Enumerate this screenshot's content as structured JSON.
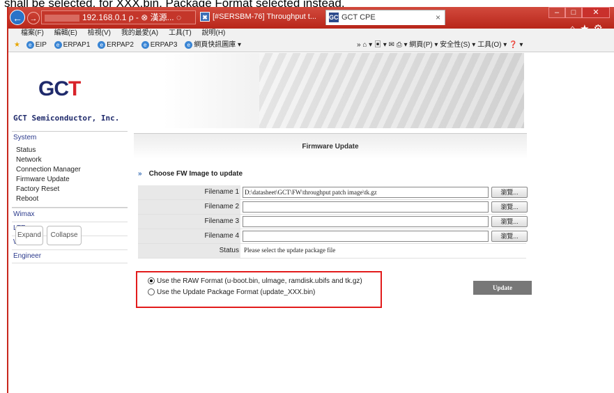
{
  "doc_caption": "shall be selected, for XXX.bin, Package Format selected instead.",
  "browser": {
    "address": "192.168.0.1",
    "address_suffix": "ρ - ⊗ 漢源... ◌",
    "tab_jira": "[#SERSBM-76] Throughput t...",
    "tab_active": "GCT CPE",
    "tab_close": "×",
    "favicon_text": "GCT",
    "menu": [
      "檔案(F)",
      "編輯(E)",
      "檢視(V)",
      "我的最愛(A)",
      "工具(T)",
      "說明(H)"
    ],
    "favorites": [
      "EIP",
      "ERPAP1",
      "ERPAP2",
      "ERPAP3",
      "網頁快訊圖庫 ▾"
    ],
    "tools": "»  ⌂ ▾  ▣ ▾  ✉  ⎙ ▾  網頁(P) ▾  安全性(S) ▾  工具(O) ▾  ❓ ▾"
  },
  "brand": {
    "logo_main": "GC",
    "logo_accent": "T",
    "company": "GCT Semiconductor, Inc."
  },
  "sidebar": {
    "system": "System",
    "system_items": [
      "Status",
      "Network",
      "Connection Manager",
      "Firmware Update",
      "Factory Reset",
      "Reboot"
    ],
    "sections": [
      "Wimax",
      "LTE",
      "WiFi",
      "Engineer"
    ],
    "expand": "Expand",
    "collapse": "Collapse"
  },
  "main": {
    "title": "Firmware Update",
    "choose_label": "Choose FW Image to update",
    "files": [
      {
        "label": "Filename 1",
        "value": "D:\\datasheet\\GCT\\FW\\throughput patch image\\tk.gz",
        "browse": "瀏覽..."
      },
      {
        "label": "Filename 2",
        "value": "",
        "browse": "瀏覽..."
      },
      {
        "label": "Filename 3",
        "value": "",
        "browse": "瀏覽..."
      },
      {
        "label": "Filename 4",
        "value": "",
        "browse": "瀏覽..."
      }
    ],
    "status_label": "Status",
    "status_value": "Please select the update package file",
    "raw_format": "Use the RAW Format (u-boot.bin, ulmage, ramdisk.ubifs and tk.gz)",
    "pkg_format": "Use the Update Package Format (update_XXX.bin)",
    "selected_format": "raw",
    "update_button": "Update"
  }
}
